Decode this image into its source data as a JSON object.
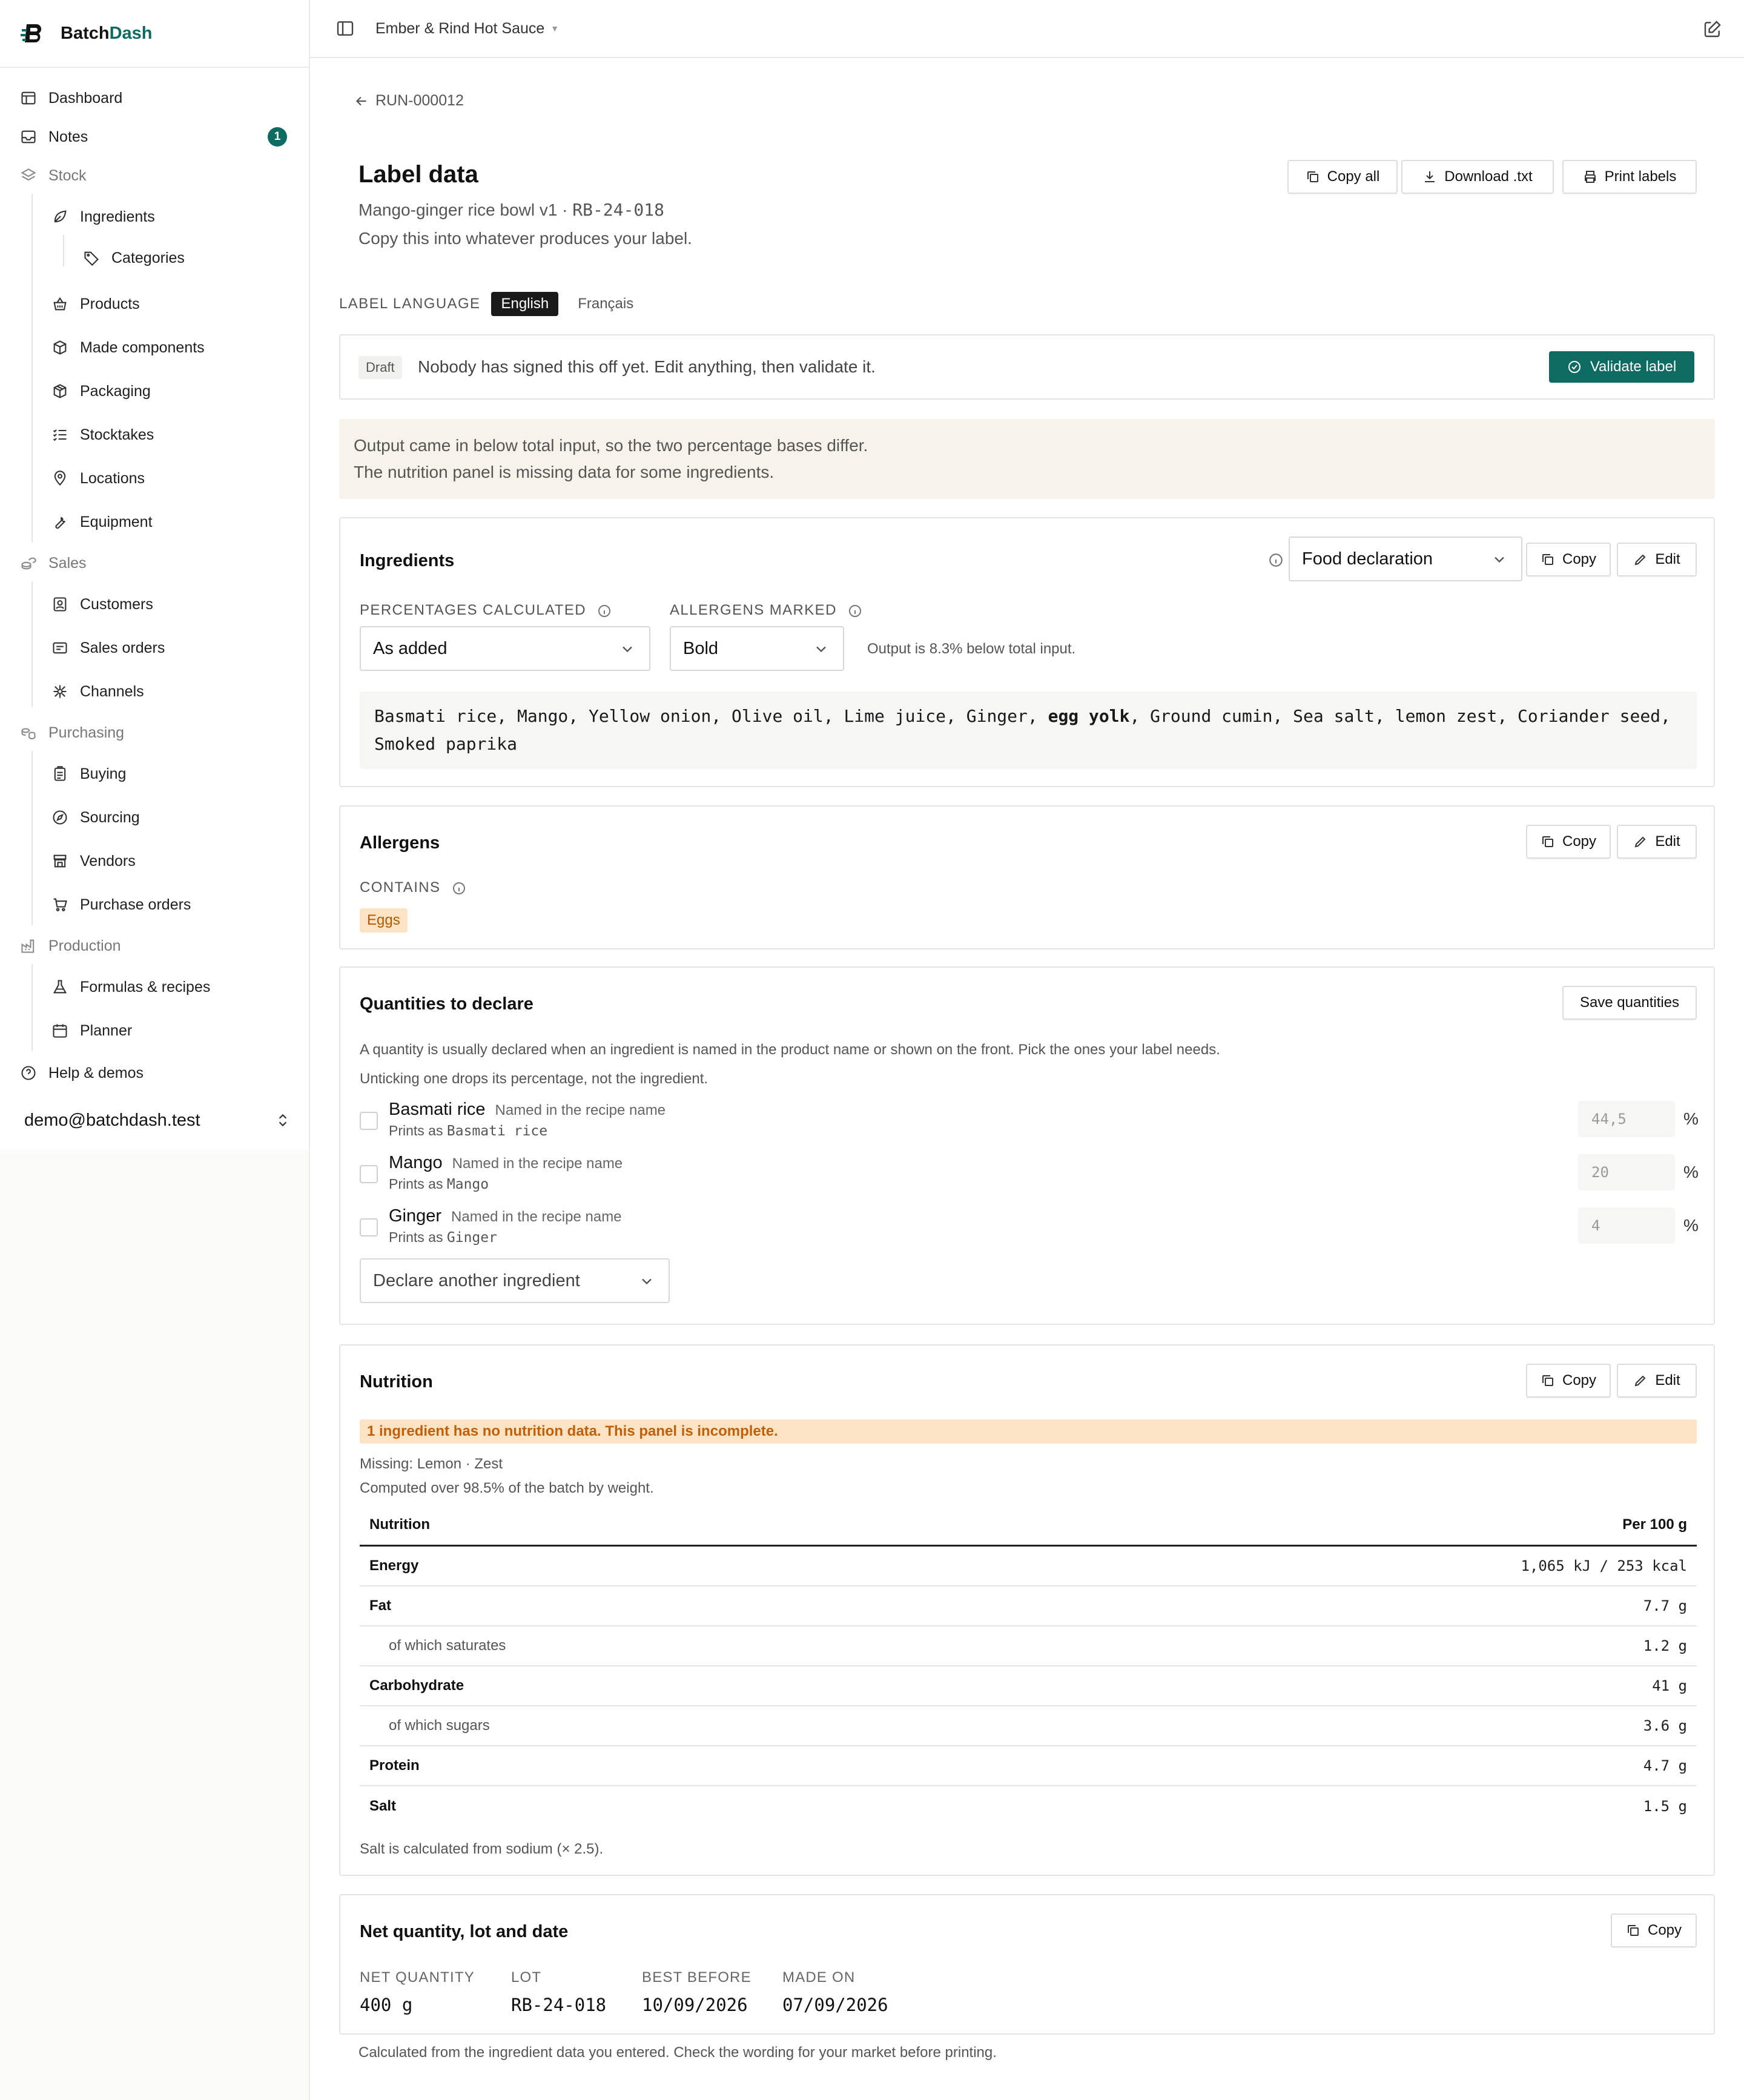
{
  "brand": {
    "name_a": "Batch",
    "name_b": "Dash",
    "accent": "#0e6b62"
  },
  "nav": {
    "items": [
      {
        "label": "Dashboard",
        "icon": "dashboard-icon"
      },
      {
        "label": "Notes",
        "icon": "inbox-icon",
        "badge": "1"
      },
      {
        "label": "Stock",
        "icon": "layers-icon"
      },
      {
        "label": "Ingredients",
        "icon": "leaf-icon"
      },
      {
        "label": "Categories",
        "icon": "tag-icon"
      },
      {
        "label": "Products",
        "icon": "basket-icon"
      },
      {
        "label": "Made components",
        "icon": "box-icon"
      },
      {
        "label": "Packaging",
        "icon": "package-icon"
      },
      {
        "label": "Stocktakes",
        "icon": "checklist-icon"
      },
      {
        "label": "Locations",
        "icon": "map-pin-icon"
      },
      {
        "label": "Equipment",
        "icon": "wrench-icon"
      },
      {
        "label": "Sales",
        "icon": "coins-icon"
      },
      {
        "label": "Customers",
        "icon": "contact-icon"
      },
      {
        "label": "Sales orders",
        "icon": "receipt-icon"
      },
      {
        "label": "Channels",
        "icon": "network-icon"
      },
      {
        "label": "Purchasing",
        "icon": "purchase-coins-icon"
      },
      {
        "label": "Buying",
        "icon": "clipboard-icon"
      },
      {
        "label": "Sourcing",
        "icon": "compass-icon"
      },
      {
        "label": "Vendors",
        "icon": "store-icon"
      },
      {
        "label": "Purchase orders",
        "icon": "cart-icon"
      },
      {
        "label": "Production",
        "icon": "factory-icon"
      },
      {
        "label": "Formulas & recipes",
        "icon": "flask-icon"
      },
      {
        "label": "Planner",
        "icon": "calendar-icon"
      },
      {
        "label": "Help & demos",
        "icon": "help-icon"
      }
    ],
    "user_email": "demo@batchdash.test"
  },
  "topbar": {
    "workspace": "Ember & Rind Hot Sauce"
  },
  "header": {
    "back_label": "RUN-000012",
    "title": "Label data",
    "subtitle_recipe": "Mango-ginger rice bowl v1 · ",
    "subtitle_lot": "RB-24-018",
    "subtitle2": "Copy this into whatever produces your label.",
    "actions": {
      "copy_all": "Copy all",
      "download": "Download .txt",
      "print": "Print labels"
    }
  },
  "language": {
    "label": "LABEL LANGUAGE",
    "selected": "English",
    "other": "Français"
  },
  "status": {
    "tag": "Draft",
    "text": "Nobody has signed this off yet. Edit anything, then validate it.",
    "validate_label": "Validate label"
  },
  "notice": {
    "line1": "Output came in below total input, so the two percentage bases differ.",
    "line2": "The nutrition panel is missing data for some ingredients."
  },
  "ingredients": {
    "title": "Ingredients",
    "format_select": "Food declaration",
    "copy": "Copy",
    "edit": "Edit",
    "pct_label": "PERCENTAGES CALCULATED",
    "pct_value": "As added",
    "allergens_label": "ALLERGENS MARKED",
    "allergens_value": "Bold",
    "output_note": "Output is 8.3% below total input.",
    "declaration_before": "Basmati rice, Mango, Yellow onion, Olive oil, Lime juice, Ginger, ",
    "declaration_bold": "egg yolk",
    "declaration_after": ", Ground cumin, Sea salt, lemon zest, Coriander seed, Smoked paprika"
  },
  "allergens": {
    "title": "Allergens",
    "copy": "Copy",
    "edit": "Edit",
    "contains_label": "CONTAINS",
    "items": [
      "Eggs"
    ]
  },
  "quantities": {
    "title": "Quantities to declare",
    "save": "Save quantities",
    "help1": "A quantity is usually declared when an ingredient is named in the product name or shown on the front. Pick the ones your label needs.",
    "help2": "Unticking one drops its percentage, not the ingredient.",
    "rows": [
      {
        "name": "Basmati rice",
        "hint": "Named in the recipe name",
        "prints_label": "Prints as ",
        "prints_value": "Basmati rice",
        "value": "44,5",
        "unit": "%"
      },
      {
        "name": "Mango",
        "hint": "Named in the recipe name",
        "prints_label": "Prints as ",
        "prints_value": "Mango",
        "value": "20",
        "unit": "%"
      },
      {
        "name": "Ginger",
        "hint": "Named in the recipe name",
        "prints_label": "Prints as ",
        "prints_value": "Ginger",
        "value": "4",
        "unit": "%"
      }
    ],
    "declare_another": "Declare another ingredient"
  },
  "nutrition": {
    "title": "Nutrition",
    "copy": "Copy",
    "edit": "Edit",
    "warning": "1 ingredient has no nutrition data. This panel is incomplete.",
    "missing": "Missing: Lemon · Zest",
    "computed": "Computed over 98.5% of the batch by weight.",
    "col_label": "Nutrition",
    "col_value": "Per 100 g",
    "rows": [
      {
        "label": "Energy",
        "value": "1,065 kJ / 253 kcal",
        "kind": "bold"
      },
      {
        "label": "Fat",
        "value": "7.7 g",
        "kind": "bold"
      },
      {
        "label": "of which saturates",
        "value": "1.2 g",
        "kind": "sub"
      },
      {
        "label": "Carbohydrate",
        "value": "41 g",
        "kind": "bold"
      },
      {
        "label": "of which sugars",
        "value": "3.6 g",
        "kind": "sub"
      },
      {
        "label": "Protein",
        "value": "4.7 g",
        "kind": "bold"
      },
      {
        "label": "Salt",
        "value": "1.5 g",
        "kind": "bold"
      }
    ],
    "salt_note": "Salt is calculated from sodium (× 2.5)."
  },
  "net": {
    "title": "Net quantity, lot and date",
    "copy": "Copy",
    "fields": [
      {
        "k": "NET QUANTITY",
        "v": "400 g"
      },
      {
        "k": "LOT",
        "v": "RB-24-018"
      },
      {
        "k": "BEST BEFORE",
        "v": "10/09/2026"
      },
      {
        "k": "MADE ON",
        "v": "07/09/2026"
      }
    ]
  },
  "footer_note": "Calculated from the ingredient data you entered. Check the wording for your market before printing."
}
